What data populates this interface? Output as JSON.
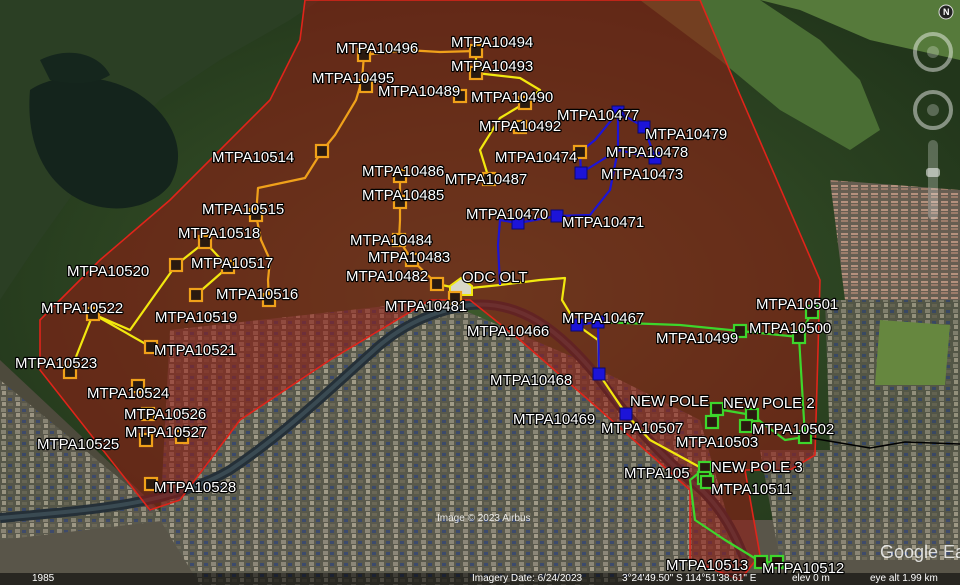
{
  "colors": {
    "area_fill": "rgba(150,25,18,0.55)",
    "area_stroke": "#e0241a",
    "orange": "#f0a11a",
    "yellow": "#f2e80f",
    "blue": "#1c14d8",
    "green": "#3dd62c",
    "black": "#000000"
  },
  "ui": {
    "compass_label": "N",
    "year_label": "1985",
    "watermark": "Image © 2023 Airbus",
    "brand": "Google Earth",
    "imagery_date": "Imagery Date: 6/24/2023",
    "coordinates": "3°24'49.50\" S  114°51'38.61\" E",
    "elevation": "elev    0 m",
    "eye_alt": "eye alt  1.99 km"
  },
  "points": [
    {
      "id": "MTPA10496",
      "label": "MTPA10496",
      "icon": "orange-pole"
    },
    {
      "id": "MTPA10494",
      "label": "MTPA10494",
      "icon": "orange-pole"
    },
    {
      "id": "MTPA10493",
      "label": "MTPA10493",
      "icon": "orange-pole"
    },
    {
      "id": "MTPA10495",
      "label": "MTPA10495",
      "icon": "orange-pole"
    },
    {
      "id": "MTPA10489",
      "label": "MTPA10489",
      "icon": "orange-pole"
    },
    {
      "id": "MTPA10490",
      "label": "MTPA10490",
      "icon": "orange-pole"
    },
    {
      "id": "MTPA10492",
      "label": "MTPA10492",
      "icon": "orange-pole"
    },
    {
      "id": "MTPA10477",
      "label": "MTPA10477",
      "icon": "blue-pole"
    },
    {
      "id": "MTPA10479",
      "label": "MTPA10479",
      "icon": "blue-pole"
    },
    {
      "id": "MTPA10478",
      "label": "MTPA10478",
      "icon": "blue-pole"
    },
    {
      "id": "MTPA10474",
      "label": "MTPA10474",
      "icon": "orange-pole"
    },
    {
      "id": "MTPA10473",
      "label": "MTPA10473",
      "icon": "blue-pole"
    },
    {
      "id": "MTPA10514",
      "label": "MTPA10514",
      "icon": "orange-pole"
    },
    {
      "id": "MTPA10486",
      "label": "MTPA10486",
      "icon": "orange-pole"
    },
    {
      "id": "MTPA10487",
      "label": "MTPA10487",
      "icon": "orange-pole"
    },
    {
      "id": "MTPA10485",
      "label": "MTPA10485",
      "icon": "orange-pole"
    },
    {
      "id": "MTPA10515",
      "label": "MTPA10515",
      "icon": "orange-pole"
    },
    {
      "id": "MTPA10470",
      "label": "MTPA10470",
      "icon": "blue-pole"
    },
    {
      "id": "MTPA10471",
      "label": "MTPA10471",
      "icon": "blue-pole"
    },
    {
      "id": "MTPA10518",
      "label": "MTPA10518",
      "icon": "orange-pole"
    },
    {
      "id": "MTPA10484",
      "label": "MTPA10484",
      "icon": "orange-pole"
    },
    {
      "id": "MTPA10483",
      "label": "MTPA10483",
      "icon": "orange-pole"
    },
    {
      "id": "MTPA10517",
      "label": "MTPA10517",
      "icon": "orange-pole"
    },
    {
      "id": "MTPA10520",
      "label": "MTPA10520",
      "icon": "orange-pole"
    },
    {
      "id": "MTPA10482",
      "label": "MTPA10482",
      "icon": "orange-pole"
    },
    {
      "id": "ODC_OLT",
      "label": "ODC OLT",
      "icon": "odc-house"
    },
    {
      "id": "MTPA10516",
      "label": "MTPA10516",
      "icon": "orange-pole"
    },
    {
      "id": "MTPA10501",
      "label": "MTPA10501",
      "icon": "green-pole"
    },
    {
      "id": "MTPA10481",
      "label": "MTPA10481",
      "icon": "orange-pole"
    },
    {
      "id": "MTPA10522",
      "label": "MTPA10522",
      "icon": "orange-pole"
    },
    {
      "id": "MTPA10467",
      "label": "MTPA10467",
      "icon": "blue-pole"
    },
    {
      "id": "MTPA10519",
      "label": "MTPA10519",
      "icon": "orange-pole"
    },
    {
      "id": "MTPA10500",
      "label": "MTPA10500",
      "icon": "green-pole"
    },
    {
      "id": "MTPA10466",
      "label": "MTPA10466",
      "icon": "blue-pole"
    },
    {
      "id": "MTPA10499",
      "label": "MTPA10499",
      "icon": "green-pole"
    },
    {
      "id": "MTPA10521",
      "label": "MTPA10521",
      "icon": "orange-pole"
    },
    {
      "id": "MTPA10523",
      "label": "MTPA10523",
      "icon": "orange-pole"
    },
    {
      "id": "MTPA10468",
      "label": "MTPA10468",
      "icon": "blue-pole"
    },
    {
      "id": "MTPA10524",
      "label": "MTPA10524",
      "icon": "orange-pole"
    },
    {
      "id": "NEW_POLE",
      "label": "NEW POLE",
      "icon": "green-pole"
    },
    {
      "id": "NEW_POLE_2",
      "label": "NEW POLE 2",
      "icon": "green-pole"
    },
    {
      "id": "MTPA10526",
      "label": "MTPA10526",
      "icon": "orange-pole"
    },
    {
      "id": "MTPA10469",
      "label": "MTPA10469",
      "icon": "blue-pole"
    },
    {
      "id": "MTPA10507",
      "label": "MTPA10507",
      "icon": "green-pole"
    },
    {
      "id": "MTPA10502",
      "label": "MTPA10502",
      "icon": "green-pole"
    },
    {
      "id": "MTPA10527",
      "label": "MTPA10527",
      "icon": "orange-pole"
    },
    {
      "id": "MTPA10503",
      "label": "MTPA10503",
      "icon": "green-pole"
    },
    {
      "id": "MTPA10525",
      "label": "MTPA10525",
      "icon": "orange-pole"
    },
    {
      "id": "NEW_POLE_3",
      "label": "NEW POLE 3",
      "icon": "green-pole"
    },
    {
      "id": "MTPA105_partial",
      "label": "MTPA105",
      "icon": "green-pole"
    },
    {
      "id": "MTPA10511",
      "label": "MTPA10511",
      "icon": "green-pole"
    },
    {
      "id": "MTPA10528",
      "label": "MTPA10528",
      "icon": "orange-pole"
    },
    {
      "id": "MTPA10513",
      "label": "MTPA10513",
      "icon": "green-pole"
    },
    {
      "id": "MTPA10512",
      "label": "MTPA10512",
      "icon": "green-pole"
    }
  ],
  "routes": [
    {
      "id": "orange-west-trunk",
      "color": "orange"
    },
    {
      "id": "orange-north-branch",
      "color": "orange"
    },
    {
      "id": "orange-center",
      "color": "orange"
    },
    {
      "id": "yellow-north",
      "color": "yellow"
    },
    {
      "id": "yellow-west",
      "color": "yellow"
    },
    {
      "id": "yellow-main",
      "color": "yellow"
    },
    {
      "id": "blue-loop",
      "color": "blue"
    },
    {
      "id": "blue-south",
      "color": "blue"
    },
    {
      "id": "green-east",
      "color": "green"
    },
    {
      "id": "green-south",
      "color": "green"
    },
    {
      "id": "black-east",
      "color": "black"
    }
  ]
}
